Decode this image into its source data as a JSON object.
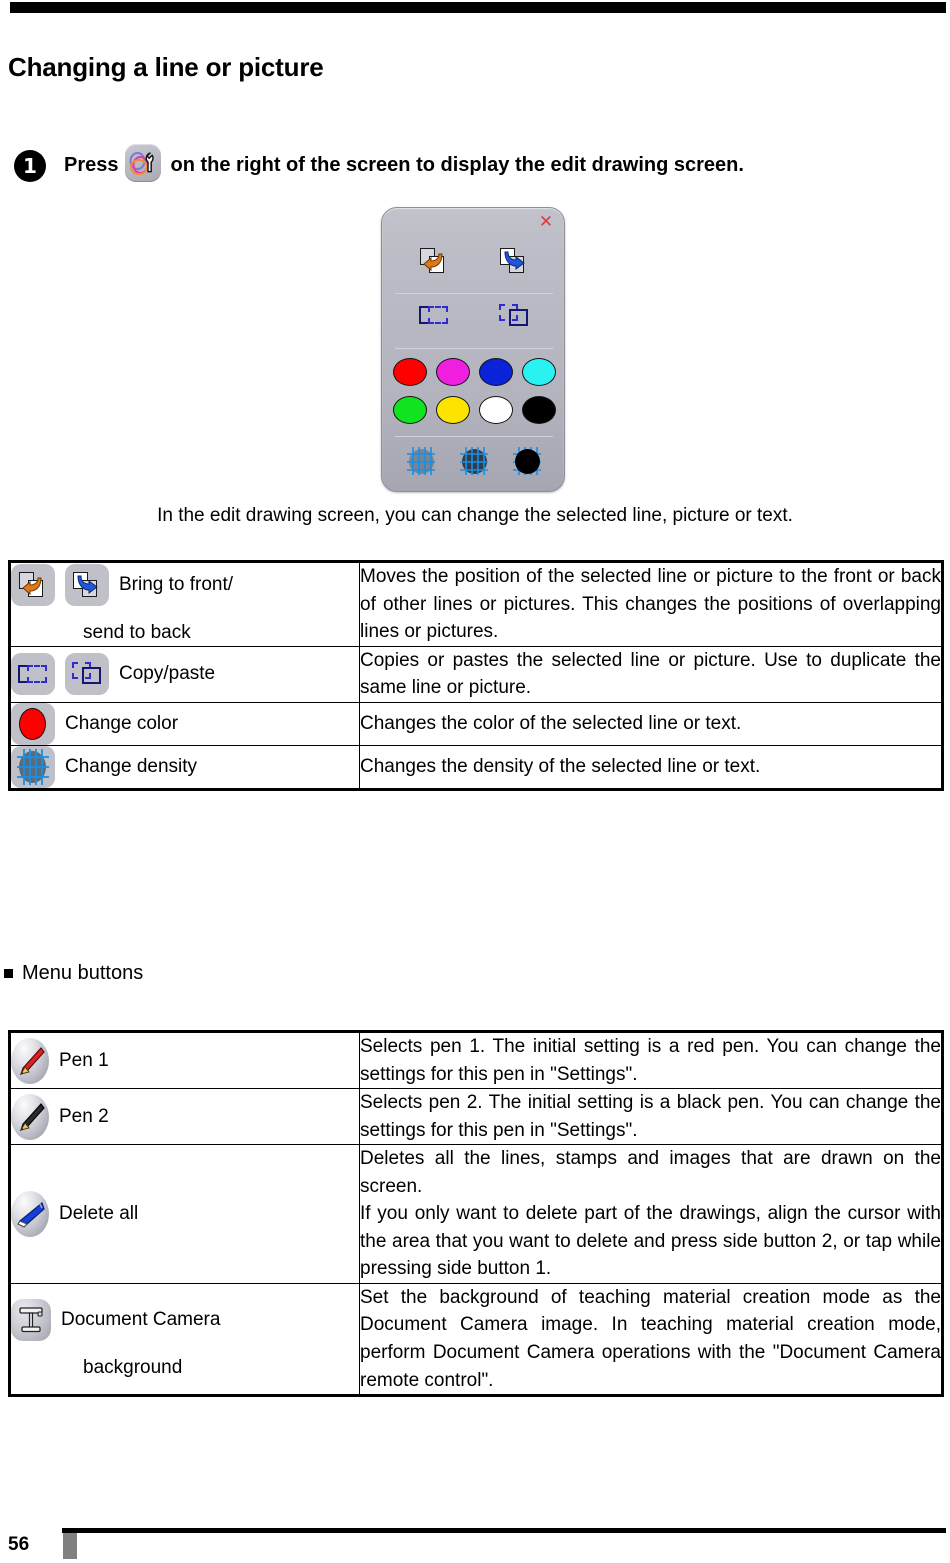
{
  "document": {
    "page_number": "56",
    "title": "Changing a line or picture",
    "step": {
      "number": "1",
      "text_before": "Press",
      "text_after": "on the right of the screen to display the edit drawing screen.",
      "icon": "wrench-tools-icon"
    },
    "caption": "In the edit drawing screen, you can change the selected line, picture or text.",
    "section_heading": "Menu buttons"
  },
  "panel": {
    "name": "edit-drawing-screen",
    "close_label": "✕",
    "tools": [
      {
        "name": "bring-to-front-icon"
      },
      {
        "name": "send-to-back-icon"
      },
      {
        "name": "copy-icon"
      },
      {
        "name": "paste-icon"
      }
    ],
    "colors": [
      {
        "name": "red",
        "hex": "#FF0000"
      },
      {
        "name": "magenta",
        "hex": "#F01FE0"
      },
      {
        "name": "blue",
        "hex": "#0A22D8"
      },
      {
        "name": "cyan",
        "hex": "#2BF2F2"
      },
      {
        "name": "green",
        "hex": "#12E320"
      },
      {
        "name": "yellow",
        "hex": "#FCE400"
      },
      {
        "name": "white",
        "hex": "#FFFFFF"
      },
      {
        "name": "black",
        "hex": "#000000"
      }
    ],
    "densities": [
      {
        "name": "density-light",
        "hex": "#6E7E8E"
      },
      {
        "name": "density-medium",
        "hex": "#2E3E4E"
      },
      {
        "name": "density-solid",
        "hex": "#000000"
      }
    ]
  },
  "edit_table": {
    "rows": [
      {
        "icons": [
          "bring-to-front-icon",
          "send-to-back-icon"
        ],
        "label_line1": "Bring to front/",
        "label_line2": "send to back",
        "description": "Moves the position of the selected line or picture to the front or back of other lines or pictures. This changes the positions of overlapping lines or pictures."
      },
      {
        "icons": [
          "copy-icon",
          "paste-icon"
        ],
        "label_line1": "Copy/paste",
        "label_line2": "",
        "description": "Copies or pastes the selected line or picture. Use to duplicate the same line or picture."
      },
      {
        "icons": [
          "change-color-icon"
        ],
        "label_line1": "Change color",
        "label_line2": "",
        "description": "Changes the color of the selected line or text."
      },
      {
        "icons": [
          "change-density-icon"
        ],
        "label_line1": "Change density",
        "label_line2": "",
        "description": "Changes the density of the selected line or text."
      }
    ]
  },
  "menu_table": {
    "rows": [
      {
        "icon": "pen-1-icon",
        "label": "Pen 1",
        "description": "Selects pen 1. The initial setting is a red pen. You can change the settings for this pen in \"Settings\"."
      },
      {
        "icon": "pen-2-icon",
        "label": "Pen 2",
        "description": "Selects pen 2. The initial setting is a black pen. You can change the settings for this pen in \"Settings\"."
      },
      {
        "icon": "delete-all-icon",
        "label": "Delete all",
        "description": "Deletes all the lines, stamps and images that are drawn on the screen.\nIf you only want to delete part of the drawings, align the cursor with the area that you want to delete and press side button 2, or tap while pressing side button 1."
      },
      {
        "icon": "document-camera-icon",
        "label_line1": "Document Camera",
        "label_line2": "background",
        "description": "Set the background of teaching material creation mode as the Document Camera image. In teaching material creation mode, perform Document Camera operations with the \"Document Camera remote control\"."
      }
    ]
  }
}
